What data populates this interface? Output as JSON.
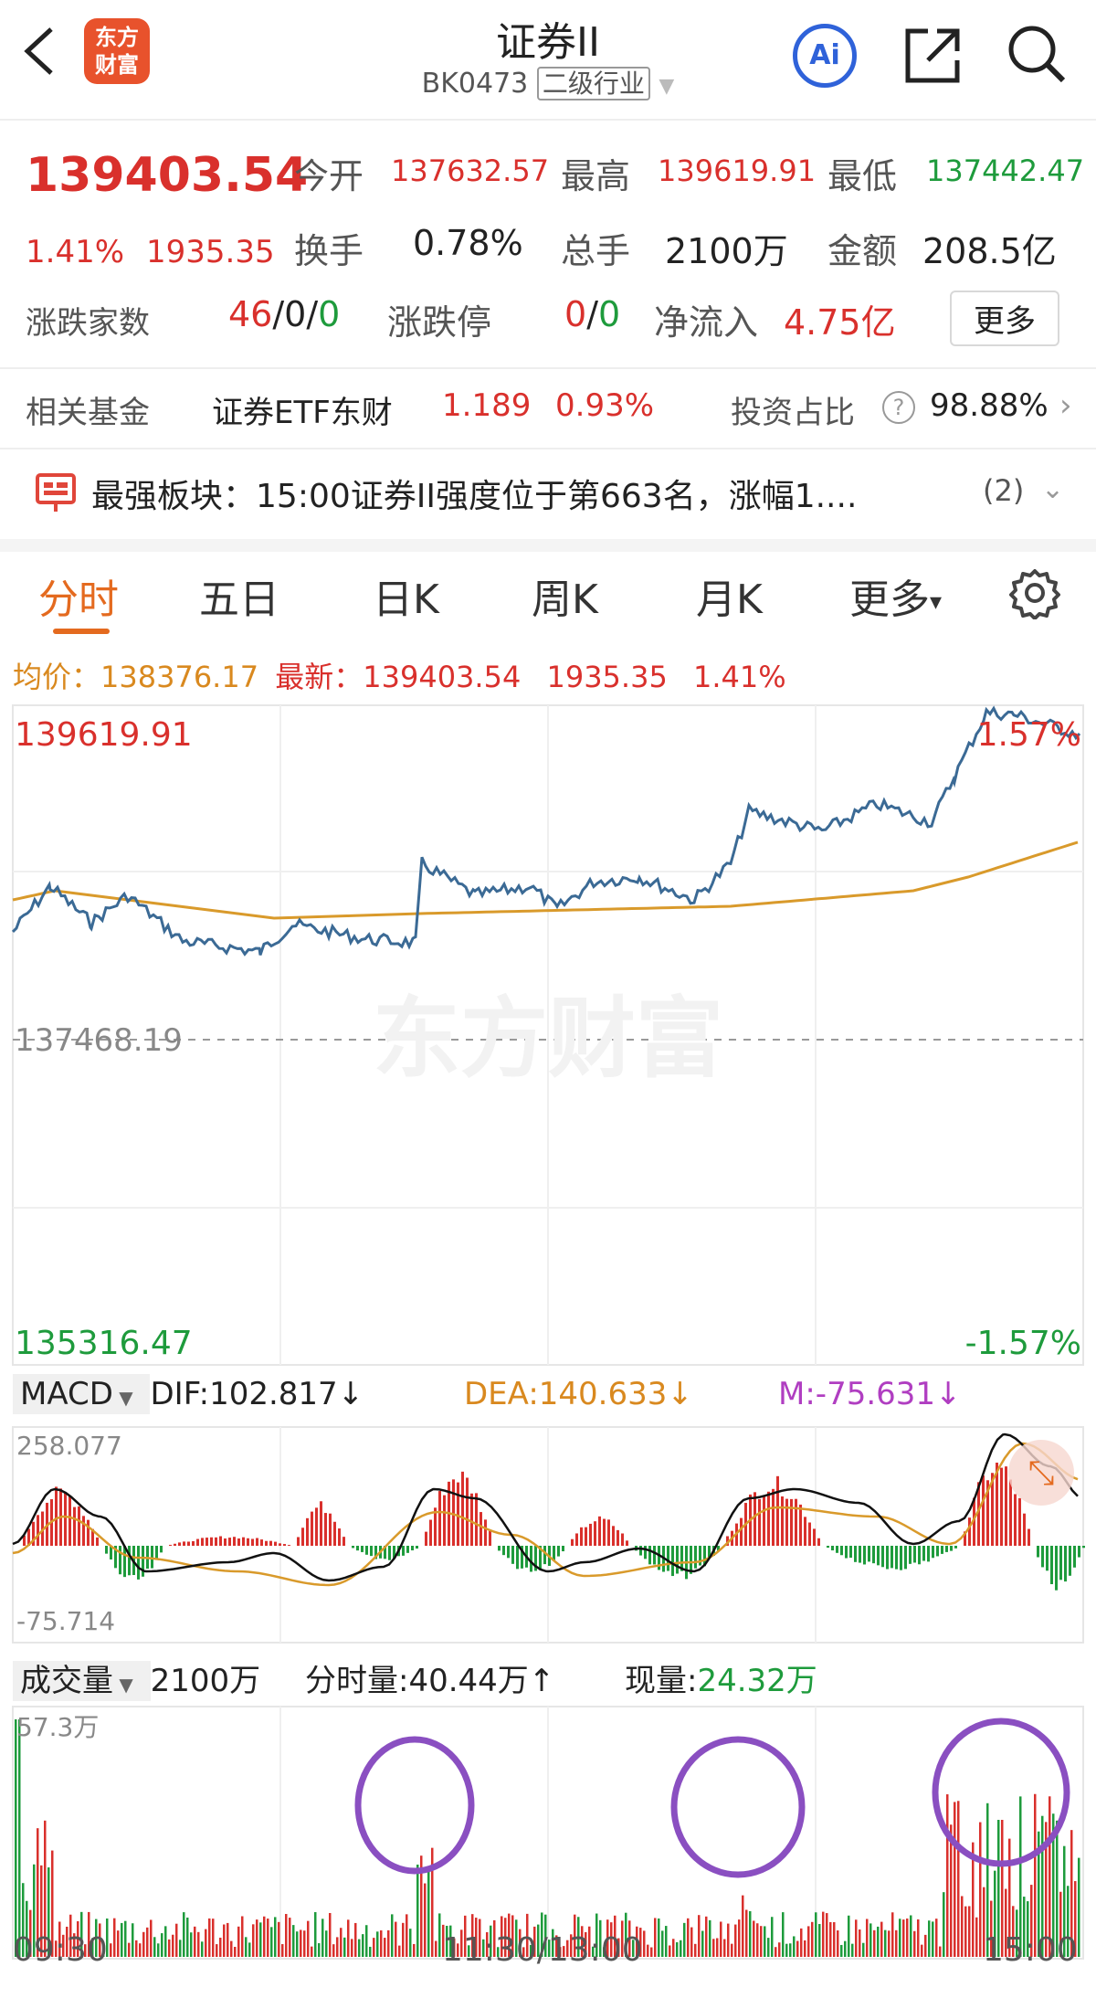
{
  "header": {
    "title": "证券II",
    "code": "BK0473",
    "category": "二级行业",
    "logo_line1": "东方",
    "logo_line2": "财富",
    "ai_label": "Ai"
  },
  "quote": {
    "price": "139403.54",
    "change_pct": "1.41%",
    "change_amt": "1935.35",
    "open_label": "今开",
    "open": "137632.57",
    "high_label": "最高",
    "high": "139619.91",
    "low_label": "最低",
    "low": "137442.47",
    "turnover_label": "换手",
    "turnover": "0.78%",
    "volume_label": "总手",
    "volume": "2100万",
    "amount_label": "金额",
    "amount": "208.5亿",
    "updown_label": "涨跌家数",
    "up_count": "46",
    "sep1": "/",
    "flat_count": "0",
    "sep2": "/",
    "down_count": "0",
    "limit_label": "涨跌停",
    "limit_up": "0",
    "limit_sep": "/",
    "limit_down": "0",
    "netflow_label": "净流入",
    "netflow": "4.75亿",
    "more_button": "更多"
  },
  "fund": {
    "label": "相关基金",
    "name": "证券ETF东财",
    "price": "1.189",
    "change": "0.93%",
    "ratio_label": "投资占比",
    "ratio": "98.88%"
  },
  "notice": {
    "title": "最强板块：",
    "text": "15:00证券II强度位于第663名，涨幅1....",
    "count": "(2)"
  },
  "tabs": [
    {
      "label": "分时",
      "active": true
    },
    {
      "label": "五日",
      "active": false
    },
    {
      "label": "日K",
      "active": false
    },
    {
      "label": "周K",
      "active": false
    },
    {
      "label": "月K",
      "active": false
    },
    {
      "label": "更多",
      "active": false
    }
  ],
  "avg_bar": {
    "avg_label": "均价：",
    "avg": "138376.17",
    "latest_label": "最新：",
    "latest": "139403.54",
    "change": "1935.35",
    "pct": "1.41%"
  },
  "price_chart": {
    "top_price": "139619.91",
    "top_pct": "1.57%",
    "mid_price": "137468.19",
    "bottom_price": "135316.47",
    "bottom_pct": "-1.57%",
    "watermark": "东方财富",
    "line_color": "#3b6a95",
    "avg_color": "#d99a2b"
  },
  "macd": {
    "selector": "MACD",
    "dif_label": "DIF:",
    "dif": "102.817",
    "dea_label": "DEA:",
    "dea": "140.633",
    "m_label": "M:",
    "m": "-75.631",
    "top_value": "258.077",
    "bottom_value": "-75.714",
    "arrow": "↓"
  },
  "volume_panel": {
    "selector": "成交量",
    "total": "2100万",
    "minute_label": "分时量:",
    "minute": "40.44万",
    "minute_arrow": "↑",
    "current_label": "现量:",
    "current": "24.32万",
    "max_label": "57.3万"
  },
  "time_axis": {
    "start": "09:30",
    "mid": "11:30/13:00",
    "end": "15:00"
  },
  "chart_data": {
    "type": "line",
    "title": "证券II",
    "x": [
      "09:30",
      "11:30/13:00",
      "15:00"
    ],
    "series": [],
    "ylim": [
      135316.47,
      139619.91
    ],
    "base": 137468.19,
    "high": 139619.91,
    "low": 137442.47,
    "close": 139403.54,
    "average": 138376.17
  },
  "colors": {
    "up": "#d9302c",
    "down": "#1e9b3c",
    "accent": "#e46a1f",
    "circle": "#8a4fc1"
  }
}
